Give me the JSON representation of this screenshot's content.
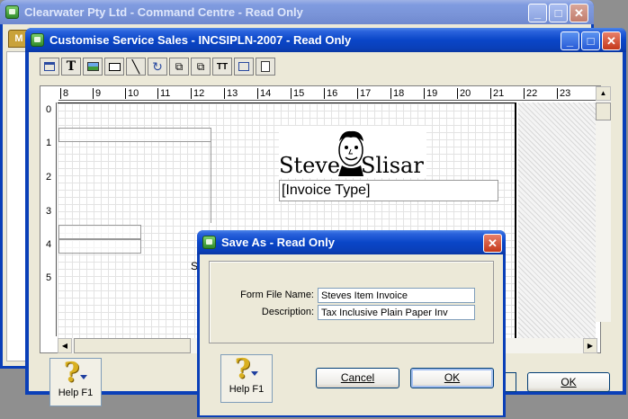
{
  "outer_window": {
    "title": "Clearwater Pty Ltd - Command Centre - Read Only"
  },
  "editor_window": {
    "title": "Customise Service Sales - INCSIPLN-2007 - Read Only",
    "ruler_marks": [
      "8",
      "9",
      "10",
      "11",
      "12",
      "13",
      "14",
      "15",
      "16",
      "17",
      "18",
      "19",
      "20",
      "21",
      "22",
      "23"
    ],
    "vruler_marks": [
      "0",
      "1",
      "2",
      "3",
      "4",
      "5"
    ],
    "logo_text": "Steve   Slisar",
    "invoice_type_field": "[Invoice Type]",
    "stray_text": "S",
    "help_label": "Help F1",
    "ok_label": "OK"
  },
  "dialog": {
    "title": "Save As - Read Only",
    "form_file_name_label": "Form File Name:",
    "form_file_name_value": "Steves Item Invoice",
    "description_label": "Description:",
    "description_value": "Tax Inclusive Plain Paper Inv",
    "help_label": "Help F1",
    "cancel_label": "Cancel",
    "ok_label": "OK"
  },
  "icons": {
    "toolbar": [
      "window-icon",
      "text-icon",
      "image-icon",
      "rectangle-icon",
      "line-icon",
      "rotate-icon",
      "bring-front-icon",
      "send-back-icon",
      "font-size-icon",
      "field-icon",
      "page-icon"
    ]
  }
}
